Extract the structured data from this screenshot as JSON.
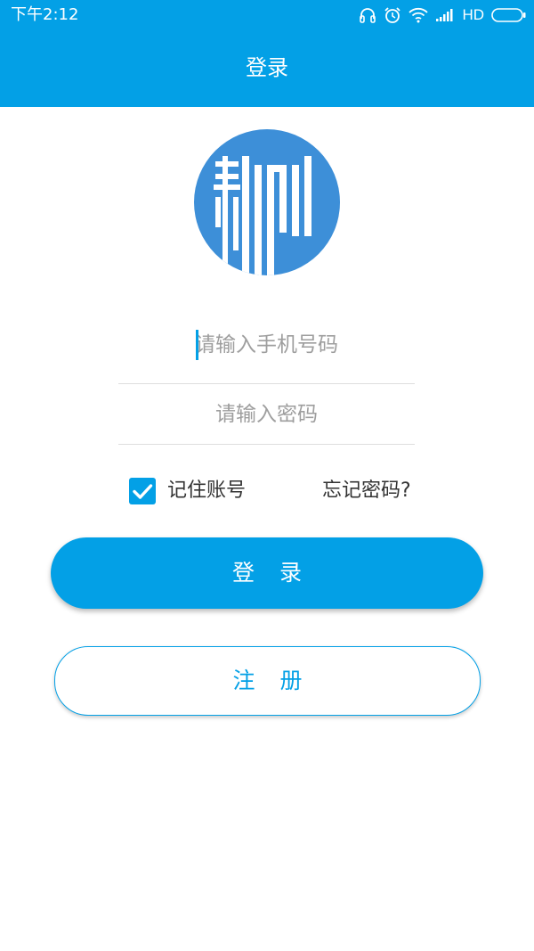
{
  "status_bar": {
    "time": "下午2:12",
    "network": "HD"
  },
  "header": {
    "title": "登录"
  },
  "form": {
    "phone_placeholder": "请输入手机号码",
    "password_placeholder": "请输入密码",
    "remember_label": "记住账号",
    "remember_checked": true,
    "forgot_label": "忘记密码?"
  },
  "buttons": {
    "login_label": "登录",
    "register_label": "注册"
  },
  "colors": {
    "accent": "#03a0e6",
    "logo": "#3d8fd8"
  },
  "icons": [
    "headset-icon",
    "alarm-icon",
    "wifi-icon",
    "signal-icon",
    "battery-icon",
    "app-logo-icon",
    "checkmark-icon"
  ]
}
